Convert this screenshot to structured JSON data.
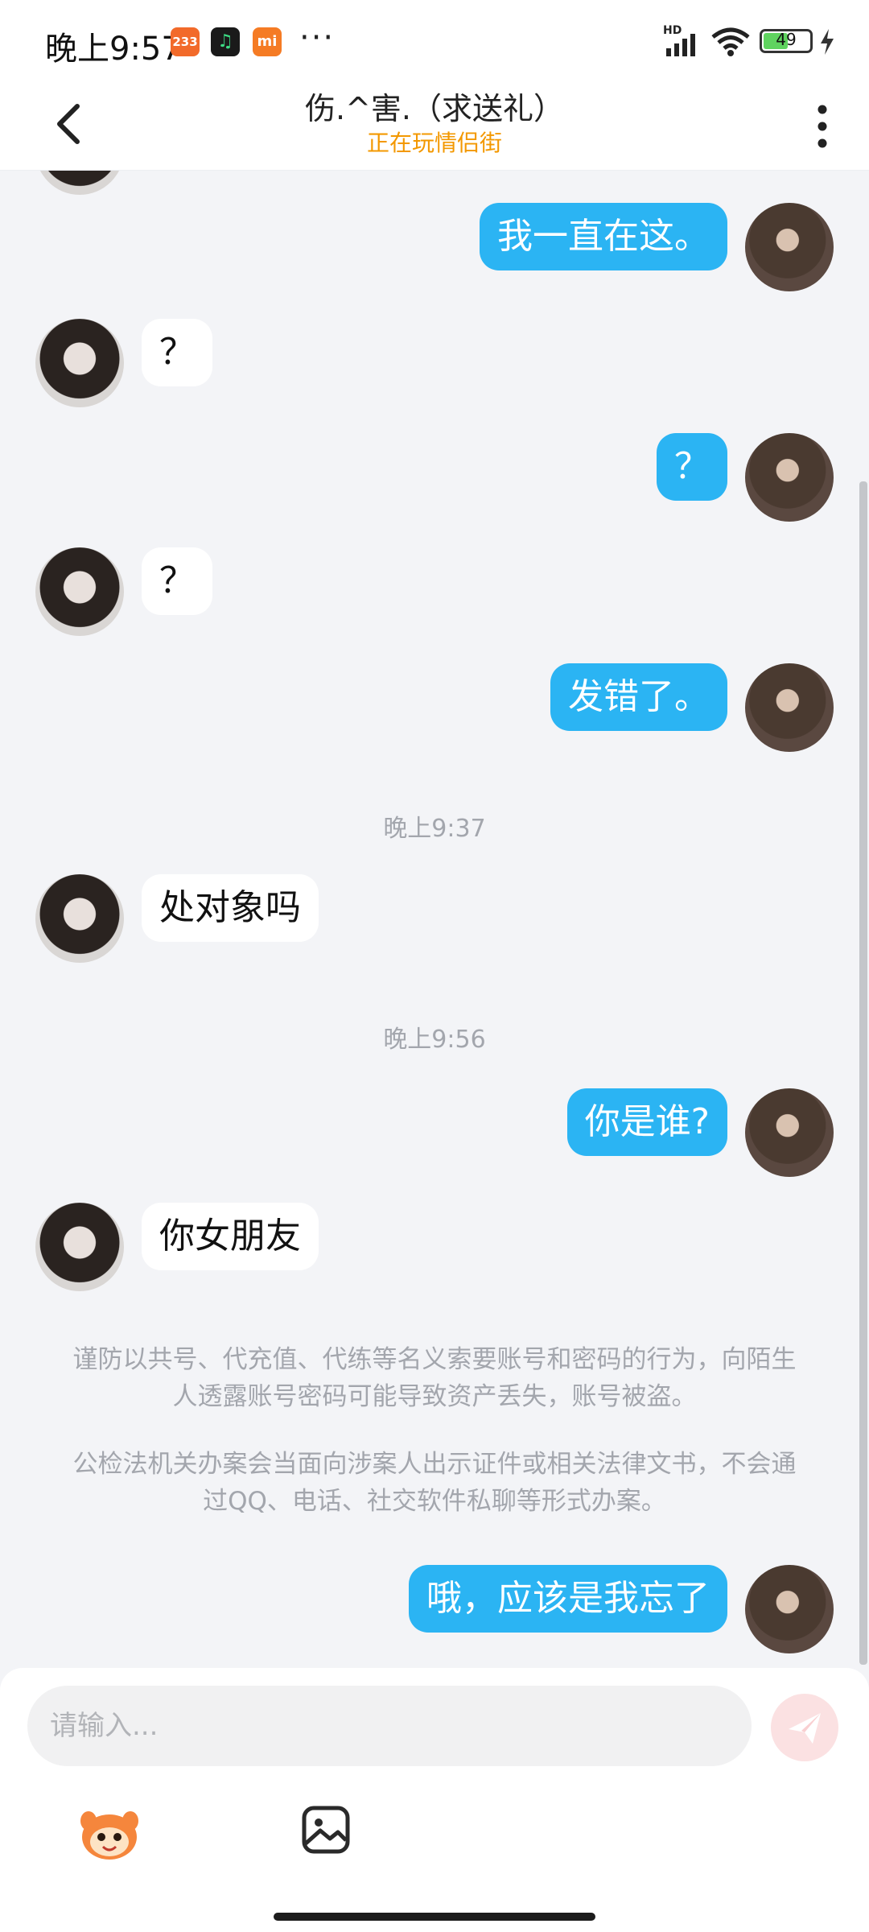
{
  "status_bar": {
    "time": "晚上9:57",
    "app_icons": [
      {
        "name": "233-app-icon",
        "label": "233",
        "color": "#f26a2a"
      },
      {
        "name": "music-app-icon",
        "label": "♫",
        "color": "#1a1a1a"
      },
      {
        "name": "mi-app-icon",
        "label": "mi",
        "color": "#f57b24"
      }
    ],
    "dots": "···",
    "network": "HD",
    "battery": "49"
  },
  "header": {
    "title": "伤.^害.（求送礼）",
    "subtitle": "正在玩情侣街",
    "subtitle_color": "#f39800"
  },
  "messages": [
    {
      "side": "self",
      "text": "我一直在这。"
    },
    {
      "side": "other",
      "text": "？"
    },
    {
      "side": "self",
      "text": "？"
    },
    {
      "side": "other",
      "text": "？"
    },
    {
      "side": "self",
      "text": "发错了。"
    },
    {
      "side": "other",
      "text": "处对象吗"
    },
    {
      "side": "self",
      "text": "你是谁?"
    },
    {
      "side": "other",
      "text": "你女朋友"
    },
    {
      "side": "self",
      "text": "哦，应该是我忘了"
    }
  ],
  "timestamps": [
    "晚上9:37",
    "晚上9:56"
  ],
  "notices": [
    "谨防以共号、代充值、代练等名义索要账号和密码的行为，向陌生人透露账号密码可能导致资产丢失，账号被盗。",
    "公检法机关办案会当面向涉案人出示证件或相关法律文书，不会通过QQ、电话、社交软件私聊等形式办案。"
  ],
  "input": {
    "placeholder": "请输入..."
  },
  "colors": {
    "self_bubble": "#2bb4f3",
    "other_bubble": "#ffffff",
    "background": "#f3f4f7",
    "send_button": "#fbe1e2"
  }
}
